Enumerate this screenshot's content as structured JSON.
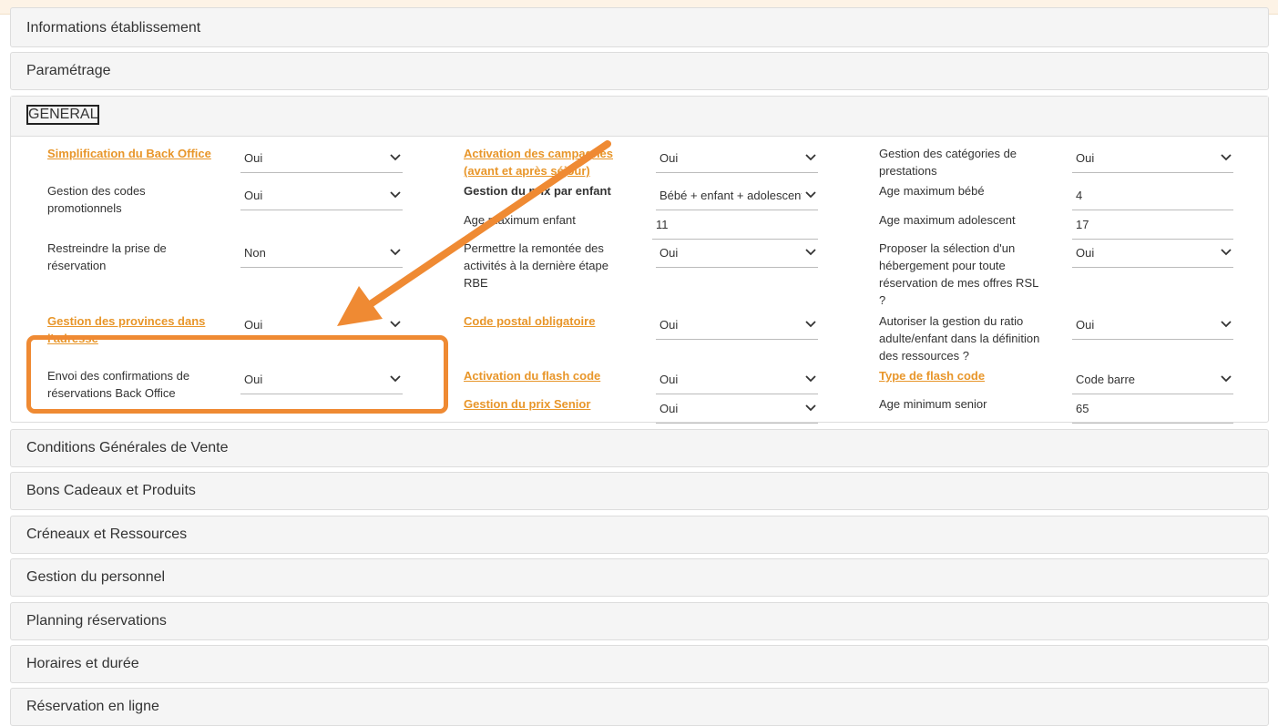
{
  "panels_top": [
    {
      "title": "Informations établissement"
    },
    {
      "title": "Paramétrage"
    }
  ],
  "general": {
    "title": "GENERAL",
    "rows": [
      {
        "label1": "Simplification du Back Office",
        "value1": "Oui",
        "label2": "Activation des campagnes (avant et après séjour)",
        "value2": "Oui",
        "label3": "Gestion des catégories de prestations",
        "value3": "Oui"
      },
      {
        "label1": "Gestion des codes promotionnels",
        "value1": "Oui",
        "label2": "Gestion du prix par enfant",
        "value2": "Bébé + enfant + adolescent",
        "label3": "Age maximum bébé",
        "value3": "4"
      },
      {
        "label2": "Age maximum enfant",
        "value2": "11",
        "label3": "Age maximum adolescent",
        "value3": "17"
      },
      {
        "label1": "Restreindre la prise de réservation",
        "value1": "Non",
        "label2": "Permettre la remontée des activités à la dernière étape RBE",
        "value2": "Oui",
        "label3": "Proposer la sélection d'un hébergement pour toute réservation de mes offres RSL ?",
        "value3": "Oui"
      },
      {
        "label1": "Gestion des provinces dans l'adresse",
        "value1": "Oui",
        "label2": "Code postal obligatoire",
        "value2": "Oui",
        "label3": "Autoriser la gestion du ratio adulte/enfant dans la définition des ressources ?",
        "value3": "Oui"
      },
      {
        "label1": "Envoi des confirmations de réservations Back Office",
        "value1": "Oui",
        "label2": "Activation du flash code",
        "value2": "Oui",
        "label3": "Type de flash code",
        "value3": "Code barre"
      },
      {
        "label2": "Gestion du prix Senior",
        "value2": "Oui",
        "label3": "Age minimum senior",
        "value3": "65"
      }
    ]
  },
  "panels_bottom": [
    {
      "title": "Conditions Générales de Vente"
    },
    {
      "title": "Bons Cadeaux et Produits"
    },
    {
      "title": "Créneaux et Ressources"
    },
    {
      "title": "Gestion du personnel"
    },
    {
      "title": "Planning réservations"
    },
    {
      "title": "Horaires et durée"
    },
    {
      "title": "Réservation en ligne"
    }
  ],
  "colors": {
    "accent": "#e8962a",
    "annotation": "#ef8a33"
  },
  "icons": {
    "select_arrow": "chevron-down-icon"
  }
}
